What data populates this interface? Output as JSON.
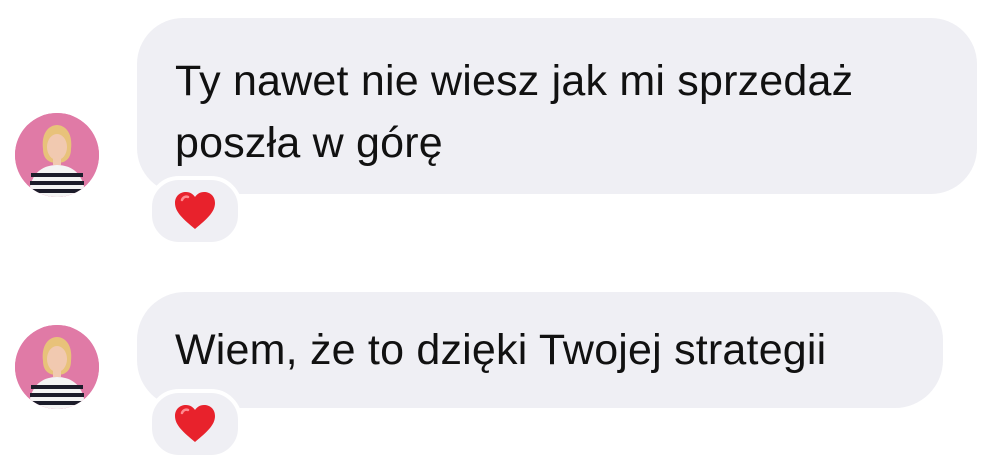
{
  "conversation": {
    "messages": [
      {
        "lines": [
          "Ty nawet nie wiesz jak mi sprzedaż",
          "poszła w górę"
        ],
        "reaction": "heart-icon"
      },
      {
        "lines": [
          "Wiem, że to dzięki Twojej strategii"
        ],
        "reaction": "heart-icon"
      }
    ]
  },
  "colors": {
    "bubble": "#efeff4",
    "text": "#111111",
    "avatar_background": "#e07aa6",
    "heart": "#e8222c"
  }
}
